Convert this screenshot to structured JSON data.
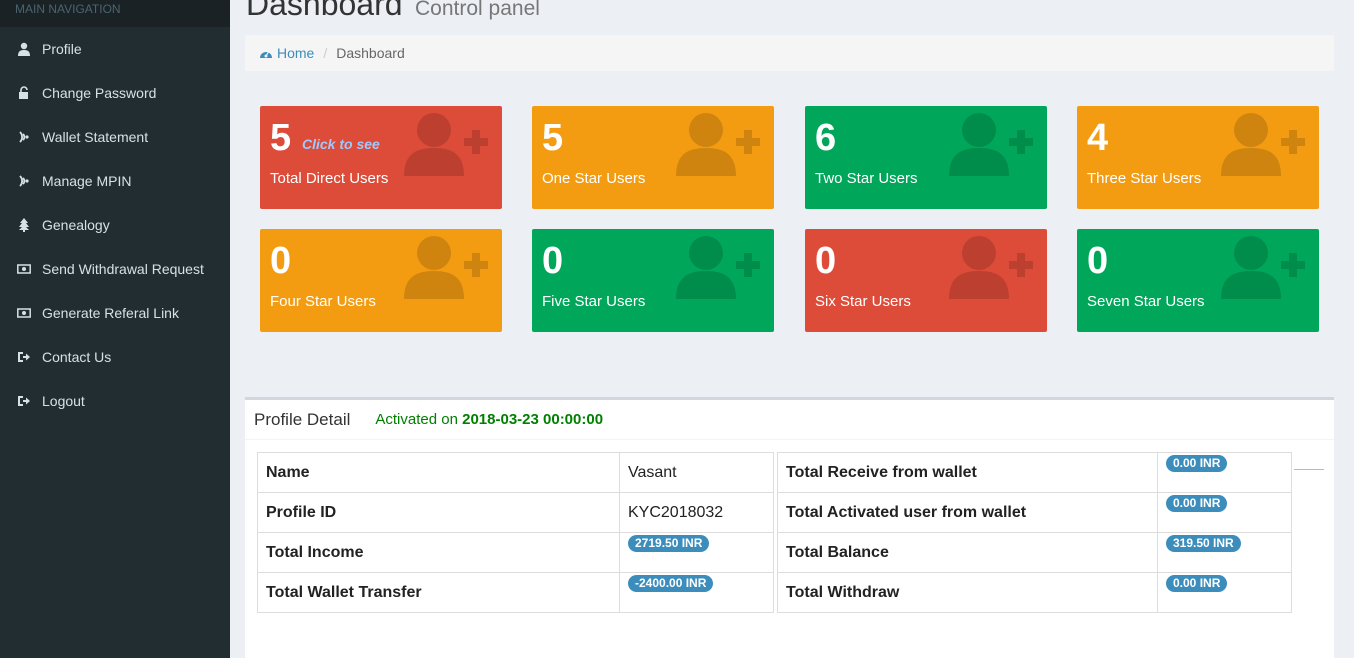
{
  "sidebar": {
    "header": "MAIN NAVIGATION",
    "items": [
      {
        "label": "Profile",
        "icon": "user-icon"
      },
      {
        "label": "Change Password",
        "icon": "unlock-icon"
      },
      {
        "label": "Wallet Statement",
        "icon": "signal-icon"
      },
      {
        "label": "Manage MPIN",
        "icon": "signal-icon"
      },
      {
        "label": "Genealogy",
        "icon": "tree-icon"
      },
      {
        "label": "Send Withdrawal Request",
        "icon": "money-icon"
      },
      {
        "label": "Generate Referal Link",
        "icon": "money-icon"
      },
      {
        "label": "Contact Us",
        "icon": "sign-out-icon"
      },
      {
        "label": "Logout",
        "icon": "sign-out-icon"
      }
    ]
  },
  "header": {
    "title": "Dashboard",
    "subtitle": "Control panel"
  },
  "breadcrumb": {
    "home": "Home",
    "current": "Dashboard"
  },
  "boxes": [
    {
      "count": "5",
      "label": "Total Direct Users",
      "note": "Click to see",
      "color": "#dd4b39"
    },
    {
      "count": "5",
      "label": "One Star Users",
      "color": "#f39c12"
    },
    {
      "count": "6",
      "label": "Two Star Users",
      "color": "#00a65a"
    },
    {
      "count": "4",
      "label": "Three Star Users",
      "color": "#f39c12"
    },
    {
      "count": "0",
      "label": "Four Star Users",
      "color": "#f39c12"
    },
    {
      "count": "0",
      "label": "Five Star Users",
      "color": "#00a65a"
    },
    {
      "count": "0",
      "label": "Six Star Users",
      "color": "#dd4b39"
    },
    {
      "count": "0",
      "label": "Seven Star Users",
      "color": "#00a65a"
    }
  ],
  "profile": {
    "title": "Profile Detail",
    "activated_prefix": "Activated on",
    "activated_date": "2018-03-23 00:00:00",
    "left": [
      {
        "key": "Name",
        "value": "Vasant"
      },
      {
        "key": "Profile ID",
        "value": "KYC2018032"
      },
      {
        "key": "Total Income",
        "badge": "2719.50 INR"
      },
      {
        "key": "Total Wallet Transfer",
        "badge": "-2400.00 INR"
      }
    ],
    "right": [
      {
        "key": "Total Receive from wallet",
        "badge": "0.00 INR"
      },
      {
        "key": "Total Activated user from wallet",
        "badge": "0.00 INR"
      },
      {
        "key": "Total Balance",
        "badge": "319.50 INR"
      },
      {
        "key": "Total Withdraw",
        "badge": "0.00 INR"
      }
    ]
  }
}
